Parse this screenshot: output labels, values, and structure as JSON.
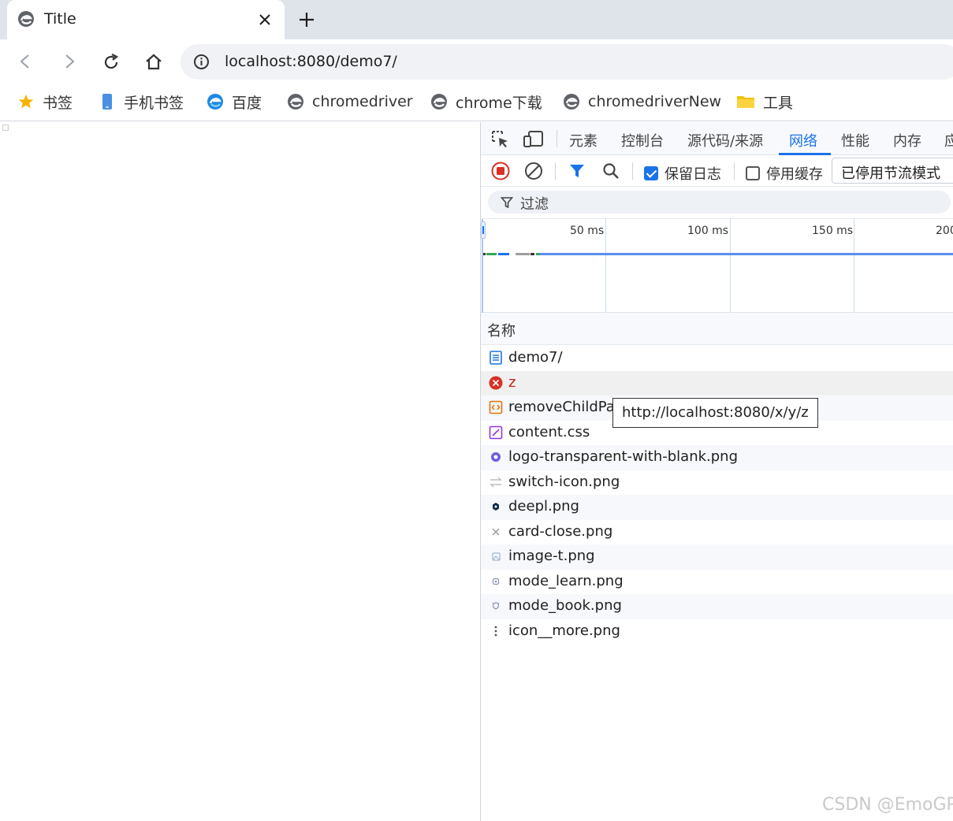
{
  "tab": {
    "title": "Title",
    "close": "×",
    "new_tab": "+"
  },
  "toolbar": {
    "url": "localhost:8080/demo7/"
  },
  "bookmarks": [
    {
      "label": "书签",
      "icon": "star-icon"
    },
    {
      "label": "手机书签",
      "icon": "phone-icon"
    },
    {
      "label": "百度",
      "icon": "edge-logo-icon"
    },
    {
      "label": "chromedriver",
      "icon": "page-icon"
    },
    {
      "label": "chrome下载",
      "icon": "page-icon"
    },
    {
      "label": "chromedriverNew",
      "icon": "page-icon"
    },
    {
      "label": "工具",
      "icon": "folder-icon"
    }
  ],
  "devtools": {
    "tabs": [
      "元素",
      "控制台",
      "源代码/来源",
      "网络",
      "性能",
      "内存",
      "应"
    ],
    "active_tab": "网络",
    "preserve_log": {
      "label": "保留日志",
      "checked": true
    },
    "disable_cache": {
      "label": "停用缓存",
      "checked": false
    },
    "throttling": "已停用节流模式",
    "filter_placeholder": "过滤",
    "timeline_ticks": [
      "50 ms",
      "100 ms",
      "150 ms",
      "200"
    ],
    "column_name": "名称",
    "requests": [
      {
        "name": "demo7/",
        "type": "document"
      },
      {
        "name": "z",
        "type": "error"
      },
      {
        "name": "removeChildPat",
        "type": "script"
      },
      {
        "name": "content.css",
        "type": "stylesheet"
      },
      {
        "name": "logo-transparent-with-blank.png",
        "type": "image"
      },
      {
        "name": "switch-icon.png",
        "type": "image"
      },
      {
        "name": "deepl.png",
        "type": "image"
      },
      {
        "name": "card-close.png",
        "type": "image"
      },
      {
        "name": "image-t.png",
        "type": "image"
      },
      {
        "name": "mode_learn.png",
        "type": "image"
      },
      {
        "name": "mode_book.png",
        "type": "image"
      },
      {
        "name": "icon__more.png",
        "type": "image"
      }
    ],
    "tooltip": "http://localhost:8080/x/y/z"
  },
  "watermark": "CSDN @EmoGP",
  "colors": {
    "accent": "#1a73e8",
    "error": "#d93025",
    "tab_strip": "#dfe3ea"
  }
}
